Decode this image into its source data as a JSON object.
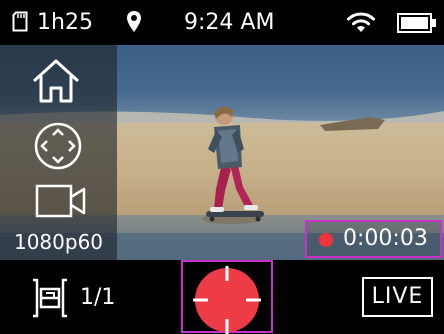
{
  "status_bar": {
    "storage_icon": "sd-card-icon",
    "battery_time": "1h25",
    "gps_icon": "location-pin-icon",
    "time": "9:24 AM",
    "wifi_icon": "wifi-icon",
    "battery_icon": "battery-icon"
  },
  "side_panel": {
    "home_icon": "home-icon",
    "nav_icon": "directional-pad-icon",
    "video_icon": "video-camera-icon",
    "resolution": "1080p60"
  },
  "recording": {
    "active": true,
    "elapsed": "0:00:03",
    "dot_color": "#f0343a"
  },
  "bottom_bar": {
    "mode_icon": "capture-mode-icon",
    "count": "1/1",
    "shutter_icon": "record-shutter-icon",
    "shutter_color": "#ee3c46",
    "live_label": "LIVE"
  },
  "colors": {
    "highlight_border": "#c832c8"
  }
}
